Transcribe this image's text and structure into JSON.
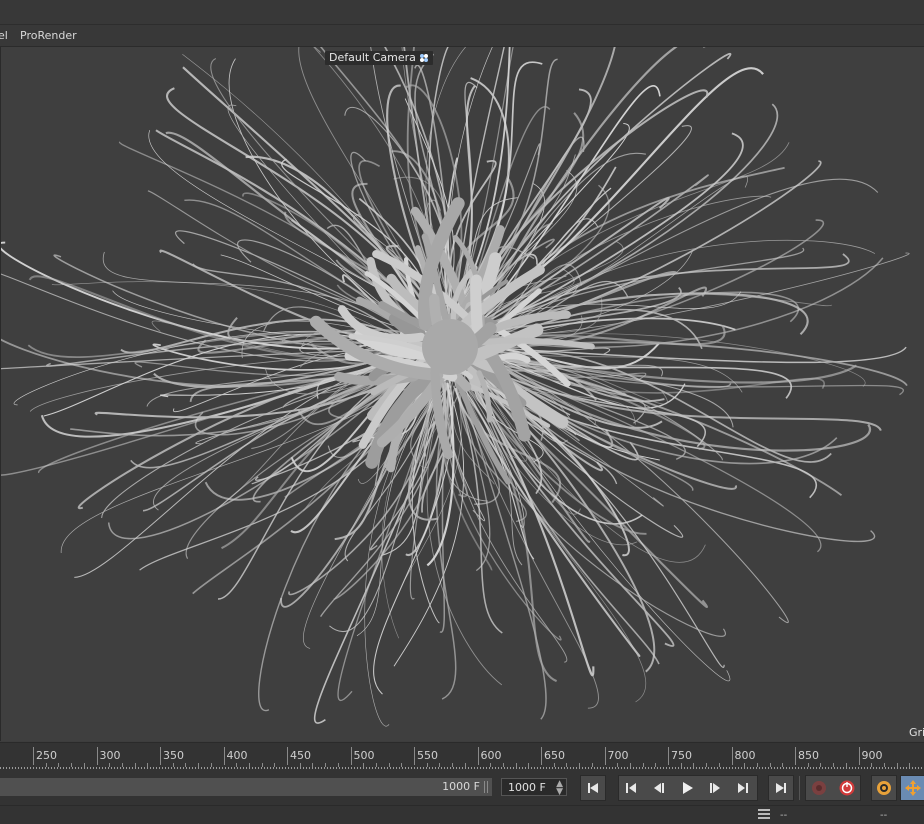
{
  "menu": {
    "items": [
      "el",
      "ProRender"
    ]
  },
  "viewport": {
    "camera_label": "Default Camera",
    "grid_label": "Gri"
  },
  "timeline": {
    "ticks": [
      "250",
      "300",
      "350",
      "400",
      "450",
      "500",
      "550",
      "600",
      "650",
      "700",
      "750",
      "800",
      "850",
      "900"
    ]
  },
  "controls": {
    "range_end_label": "1000 F",
    "end_frame_value": "1000 F",
    "buttons": [
      "go-to-start",
      "go-to-previous-key",
      "step-back",
      "play",
      "step-forward",
      "go-to-next-key",
      "go-to-end",
      "record",
      "autokey",
      "keyframe-settings",
      "move-tool"
    ]
  },
  "status": {
    "left": "--",
    "right": "--"
  },
  "colors": {
    "viewport_bg": "#3f3f3f",
    "accent_orange": "#e8a23a",
    "record_red": "#d23a3a",
    "model_gray": "#c8c8c8"
  }
}
